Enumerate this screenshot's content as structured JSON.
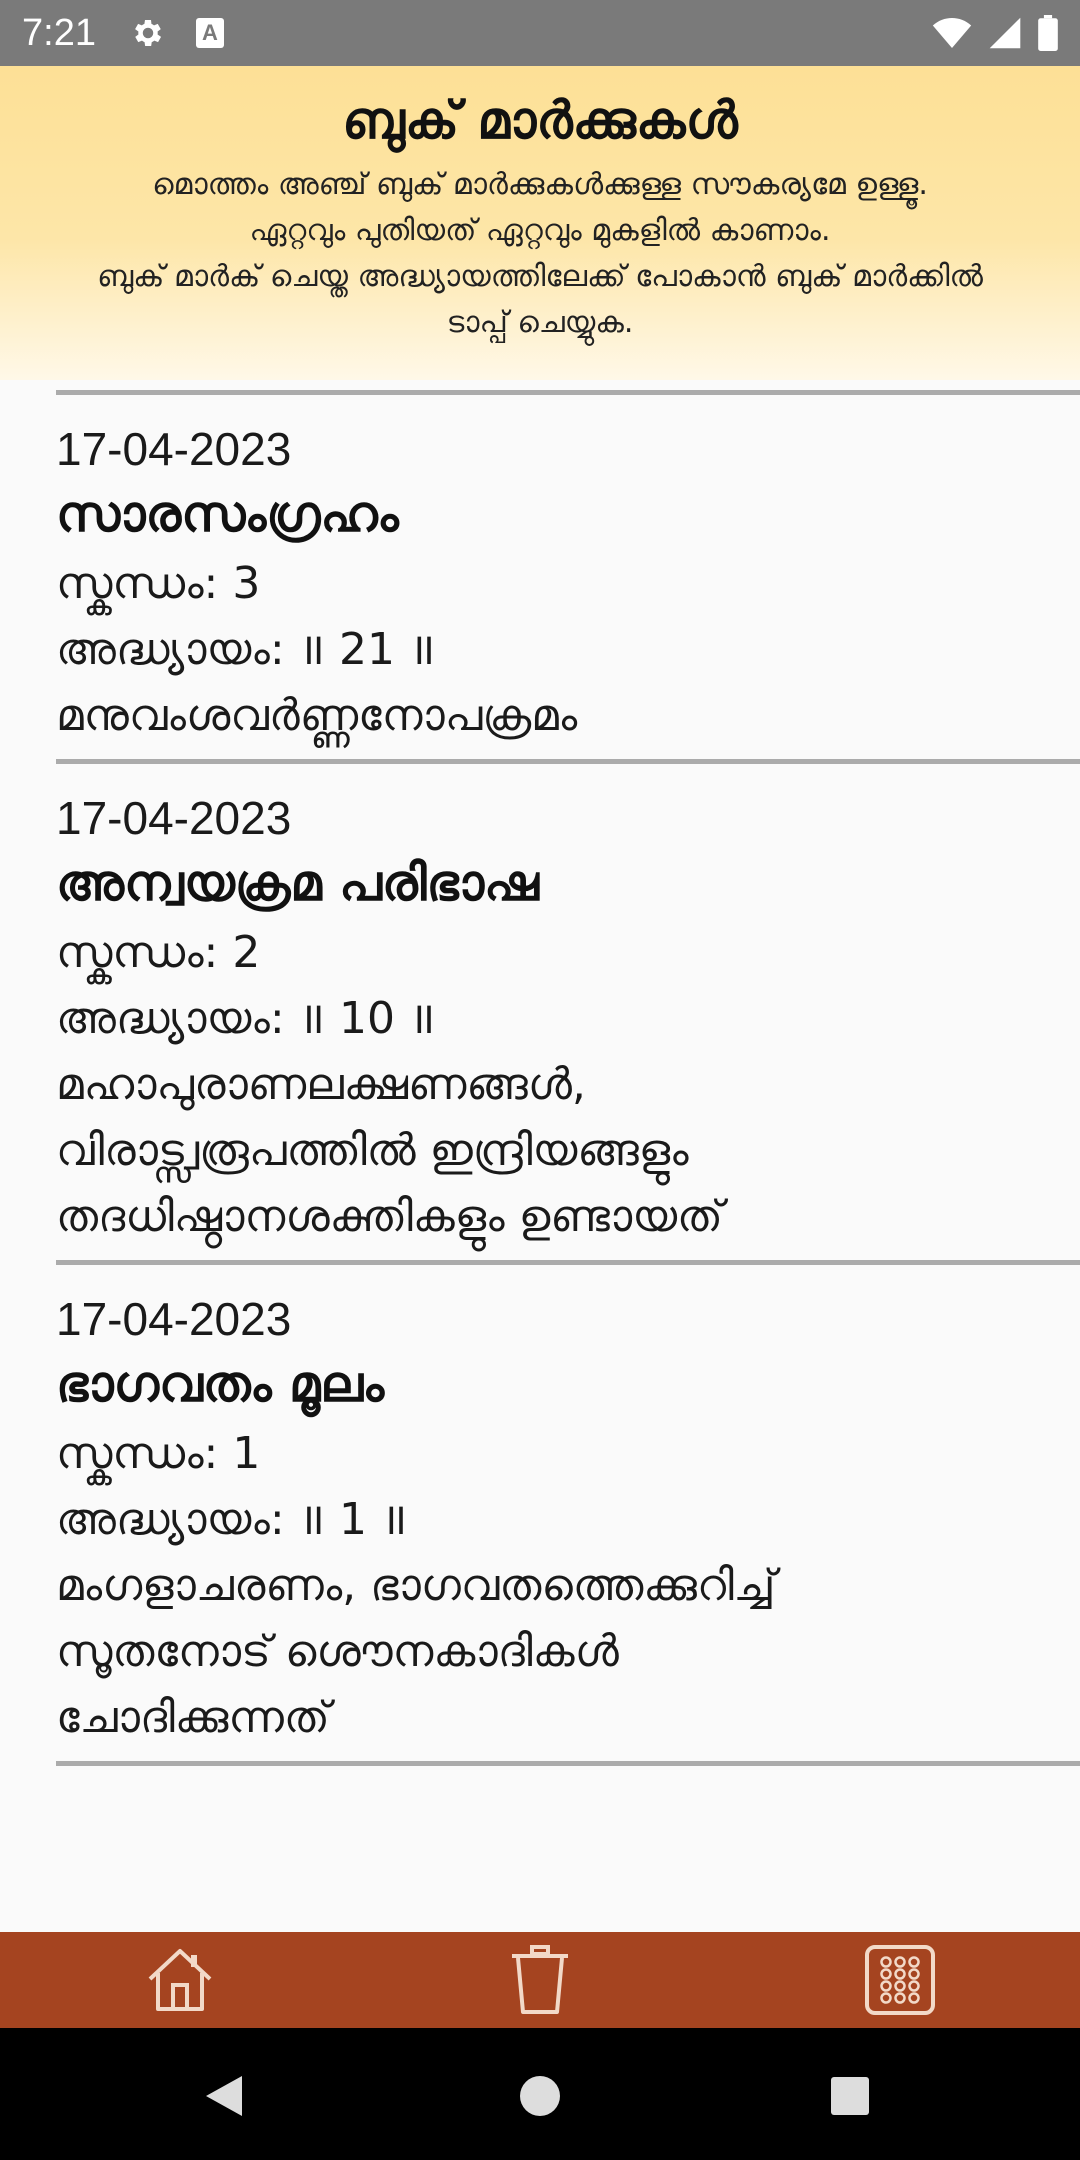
{
  "status_bar": {
    "time": "7:21",
    "icons": [
      "gear-icon",
      "a-badge-icon",
      "wifi-icon",
      "signal-icon",
      "battery-icon"
    ],
    "notification_badge": "A"
  },
  "header": {
    "title": "ബുക് മാർക്കുകൾ",
    "desc_lines": [
      "മൊത്തം അഞ്ച് ബുക് മാർക്കുകൾക്കുള്ള സൗകര്യമേ ഉള്ളൂ.",
      "ഏറ്റവും പുതിയത് ഏറ്റവും മുകളിൽ കാണാം.",
      "ബുക് മാർക് ചെയ്ത അദ്ധ്യായത്തിലേക്ക് പോകാൻ ബുക് മാർക്കിൽ",
      "ടാപ്പ് ചെയ്യുക."
    ]
  },
  "labels": {
    "skandham": "സ്കന്ധം:",
    "adhyayam": "അദ്ധ്യായം:"
  },
  "bookmarks": [
    {
      "date": "17-04-2023",
      "title": "സാരസംഗ്രഹം",
      "skandham": "3",
      "adhyayam": "॥ 21 ॥",
      "desc_lines": [
        "മനുവംശവർണ്ണനോപക്രമം"
      ]
    },
    {
      "date": "17-04-2023",
      "title": "അന്വയക്രമ പരിഭാഷ",
      "skandham": "2",
      "adhyayam": "॥ 10 ॥",
      "desc_lines": [
        "മഹാപുരാണലക്ഷണങ്ങൾ,",
        "വിരാട്സ്വരൂപത്തിൽ ഇന്ദ്രിയങ്ങളും",
        "തദധിഷ്ഠാനശക്തികളും ഉണ്ടായത്"
      ]
    },
    {
      "date": "17-04-2023",
      "title": "ഭാഗവതം മൂലം",
      "skandham": "1",
      "adhyayam": "॥ 1 ॥",
      "desc_lines": [
        "മംഗളാചരണം, ഭാഗവതത്തെക്കുറിച്ച്",
        "സൂതനോട് ശൌനകാദികൾ",
        "ചോദിക്കുന്നത്"
      ]
    }
  ],
  "toolbar": {
    "icons": [
      "home-icon",
      "trash-icon",
      "grid-icon"
    ],
    "color": "#a54420"
  },
  "nav_bar": {
    "icons": [
      "back-icon",
      "home-circle-icon",
      "recents-icon"
    ]
  },
  "colors": {
    "header_top": "#fde096",
    "header_bottom": "#fff8e8",
    "status_bar": "#7a7a7a",
    "divider": "#ababab"
  }
}
